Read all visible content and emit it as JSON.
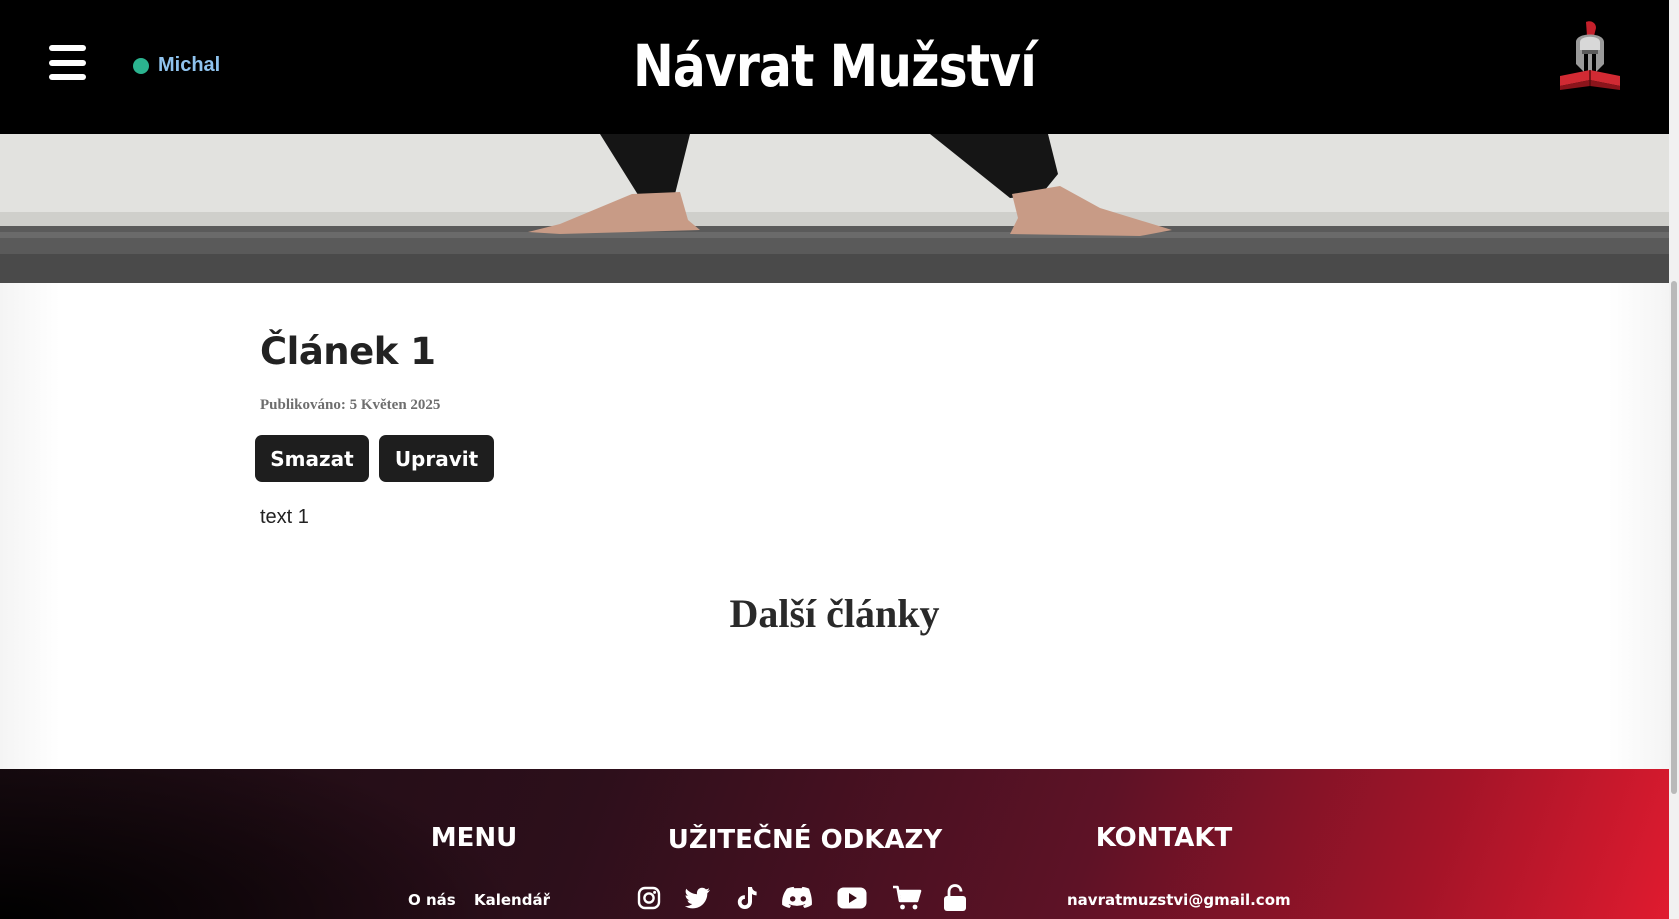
{
  "header": {
    "site_title": "Návrat Mužství",
    "user_name": "Michal",
    "user_status_color": "#2bb38f",
    "menu_icon": "hamburger-menu-icon",
    "logo_icon": "spartan-helmet-book-logo"
  },
  "article": {
    "title": "Článek 1",
    "published": "Publikováno: 5 Květen 2025",
    "delete_label": "Smazat",
    "edit_label": "Upravit",
    "body": "text 1"
  },
  "more_articles": {
    "heading": "Další články"
  },
  "footer": {
    "menu_heading": "MENU",
    "menu_items": [
      "O nás",
      "Kalendář"
    ],
    "links_heading": "UŽITEČNÉ ODKAZY",
    "social_icons": [
      "instagram-icon",
      "twitter-icon",
      "tiktok-icon",
      "discord-icon",
      "youtube-icon",
      "cart-icon",
      "unlock-icon"
    ],
    "contact_heading": "KONTAKT",
    "email": "navratmuzstvi@gmail.com"
  },
  "colors": {
    "header_bg": "#000000",
    "button_bg": "#1e1e1e",
    "footer_accent": "#e01b2f",
    "user_name_color": "#8fc3ee"
  }
}
